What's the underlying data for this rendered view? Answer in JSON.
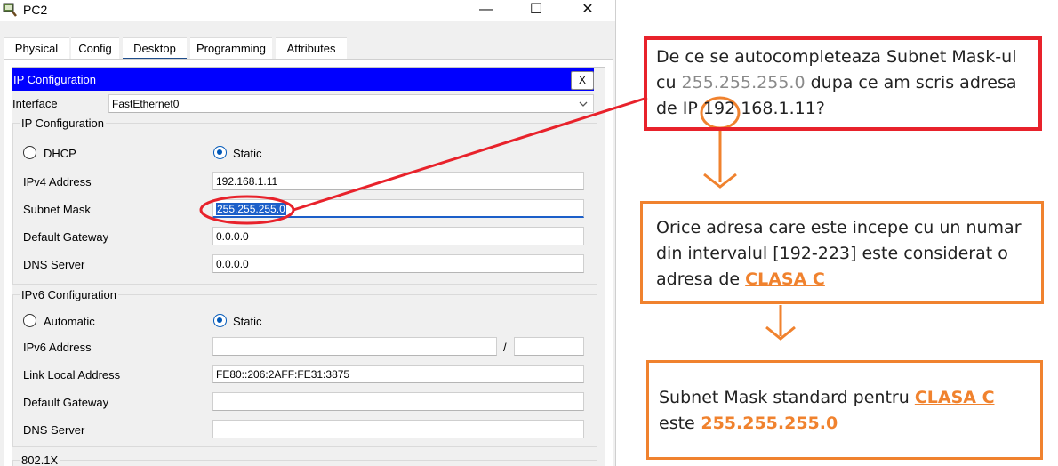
{
  "window": {
    "title": "PC2",
    "minimize": "—",
    "maximize": "☐",
    "close": "✕"
  },
  "tabs": [
    "Physical",
    "Config",
    "Desktop",
    "Programming",
    "Attributes"
  ],
  "active_tab": "Desktop",
  "ip_config": {
    "header": "IP Configuration",
    "close_label": "X",
    "interface_label": "Interface",
    "interface_value": "FastEthernet0",
    "ipv4_section": "IP Configuration",
    "dhcp_label": "DHCP",
    "static_label": "Static",
    "ipv4_label": "IPv4 Address",
    "ipv4_value": "192.168.1.11",
    "subnet_label": "Subnet Mask",
    "subnet_value": "255.255.255.0",
    "gateway_label": "Default Gateway",
    "gateway_value": "0.0.0.0",
    "dns_label": "DNS Server",
    "dns_value": "0.0.0.0",
    "ipv6_section": "IPv6 Configuration",
    "auto_label": "Automatic",
    "static6_label": "Static",
    "ipv6_label": "IPv6 Address",
    "ipv6_value": "",
    "prefix_sep": "/",
    "prefix_value": "",
    "linklocal_label": "Link Local Address",
    "linklocal_value": "FE80::206:2AFF:FE31:3875",
    "gateway6_label": "Default Gateway",
    "gateway6_value": "",
    "dns6_label": "DNS Server",
    "dns6_value": "",
    "dot1x_section": "802.1X"
  },
  "annotations": {
    "q1": "De ce se autocompleteaza Subnet Mask-ul",
    "q2a": "cu ",
    "q2b": "255.255.255.0",
    "q2c": "  dupa ce am scris adresa",
    "q3a": "de IP ",
    "q3b": "192",
    "q3c": " 168.1.11?",
    "a1": "Orice adresa care este incepe cu un numar",
    "a2": "din intervalul  [192-223]  este considerat o",
    "a3a": "adresa de ",
    "a3b": "CLASA C",
    "s1a": "Subnet Mask standard pentru ",
    "s1b": "CLASA C",
    "s2a": "este",
    "s2b": " 255.255.255.0"
  },
  "colors": {
    "red": "#e8222b",
    "orange": "#f0822e",
    "header_blue": "#0000ff"
  }
}
